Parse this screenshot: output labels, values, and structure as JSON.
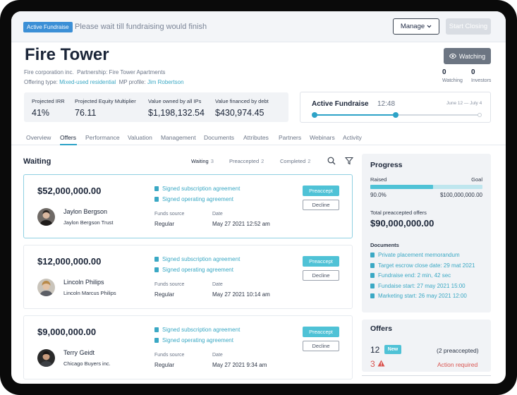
{
  "banner": {
    "badge": "Active Fundraise",
    "message": "Please wait till fundraising would finish",
    "manage_label": "Manage",
    "start_closing_label": "Start Closing"
  },
  "header": {
    "title": "Fire Tower",
    "company": "Fire corporation inc.",
    "partnership_label": "Partnership:",
    "partnership": "Fire Tower Apartments",
    "offering_label": "Offering type:",
    "offering": "Mixed-used residential",
    "mp_label": "MP profile:",
    "mp": "Jim Robertson",
    "watching_button": "Watching",
    "watching_count": "0",
    "watching_label": "Watching",
    "investors_count": "0",
    "investors_label": "Investors"
  },
  "metrics": [
    {
      "label": "Projected IRR",
      "value": "41%"
    },
    {
      "label": "Projected Equity Multiplier",
      "value": "76.11"
    },
    {
      "label": "Value owned by all IPs",
      "value": "$1,198,132.54"
    },
    {
      "label": "Value financed by debt",
      "value": "$430,974.45"
    }
  ],
  "fundraise": {
    "title": "Active Fundraise",
    "time": "12:48",
    "dates": "June 12 — July 4",
    "progress": 0.49
  },
  "tabs": [
    "Overview",
    "Offers",
    "Performance",
    "Valuation",
    "Management",
    "Documents",
    "Attributes",
    "Partners",
    "Webinars",
    "Activity"
  ],
  "list": {
    "title": "Waiting",
    "filters": [
      {
        "label": "Waiting",
        "count": "3"
      },
      {
        "label": "Preaccepted",
        "count": "2"
      },
      {
        "label": "Completed",
        "count": "2"
      }
    ]
  },
  "offers": [
    {
      "amount": "$52,000,000.00",
      "name": "Jaylon Bergson",
      "entity": "Jaylon Bergson Trust",
      "doc1": "Signed subscription agreement",
      "doc2": "Signed operating agreement",
      "funds_label": "Funds source",
      "funds": "Regular",
      "date_label": "Date",
      "date": "May 27 2021 12:52 am",
      "preaccept": "Preaccept",
      "decline": "Decline"
    },
    {
      "amount": "$12,000,000.00",
      "name": "Lincoln Philips",
      "entity": "Lincoln Marcus Philips",
      "doc1": "Signed subscription agreement",
      "doc2": "Signed operating agreement",
      "funds_label": "Funds source",
      "funds": "Regular",
      "date_label": "Date",
      "date": "May 27 2021 10:14 am",
      "preaccept": "Preaccept",
      "decline": "Decline"
    },
    {
      "amount": "$9,000,000.00",
      "name": "Terry Geidt",
      "entity": "Chicago Buyers inc.",
      "doc1": "Signed subscription agreement",
      "doc2": "Signed operating agreement",
      "funds_label": "Funds source",
      "funds": "Regular",
      "date_label": "Date",
      "date": "May 27 2021 9:34 am",
      "preaccept": "Preaccept",
      "decline": "Decline"
    }
  ],
  "progress": {
    "title": "Progress",
    "raised_label": "Raised",
    "goal_label": "Goal",
    "percent": "90.0%",
    "fill": 0.56,
    "goal": "$100,000,000.00",
    "total_label": "Total preaccepted offers",
    "total": "$90,000,000.00",
    "documents_label": "Documents",
    "documents": [
      "Private placement memorandum",
      "Target escrow close date: 29 mat 2021",
      "Fundraise end: 2 min, 42 sec",
      "Fundaise start: 27 may 2021 15:00",
      "Marketing start: 26 may 2021 12:00"
    ]
  },
  "offers_panel": {
    "title": "Offers",
    "count": "12",
    "new_badge": "New",
    "preaccepted": "(2 preaccepted)",
    "action_count": "3",
    "action_text": "Action required"
  },
  "colors": {
    "accent": "#4fc2d6",
    "link": "#3aa8c4",
    "warning": "#d9534f",
    "badge": "#3b8fd6"
  }
}
